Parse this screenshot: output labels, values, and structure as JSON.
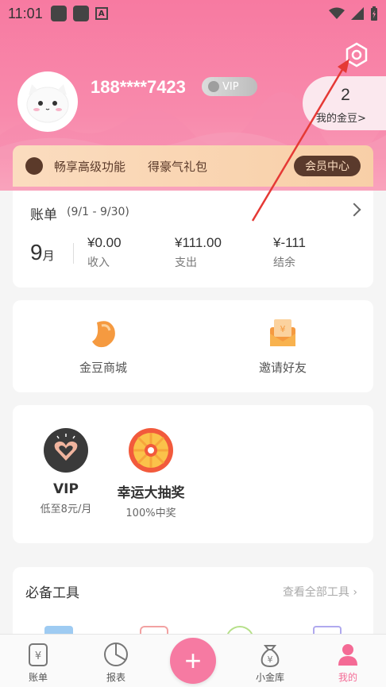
{
  "status_bar": {
    "time": "11:01"
  },
  "profile": {
    "phone": "188****7423",
    "vip_label": "VIP",
    "gold_count": "2",
    "gold_label": "我的金豆>"
  },
  "member_banner": {
    "text1": "畅享高级功能",
    "text2": "得豪气礼包",
    "button": "会员中心"
  },
  "bill": {
    "title": "账单",
    "range": "(9/1 - 9/30)",
    "month_num": "9",
    "month_unit": "月",
    "income_value": "¥0.00",
    "income_label": "收入",
    "expense_value": "¥111.00",
    "expense_label": "支出",
    "balance_value": "¥-111",
    "balance_label": "结余"
  },
  "shop": {
    "items": [
      {
        "label": "金豆商城"
      },
      {
        "label": "邀请好友"
      }
    ]
  },
  "promo": {
    "items": [
      {
        "title": "VIP",
        "sub": "低至8元/月"
      },
      {
        "title": "幸运大抽奖",
        "sub": "100%中奖"
      }
    ]
  },
  "tools": {
    "title": "必备工具",
    "link": "查看全部工具"
  },
  "tabbar": {
    "items": [
      {
        "label": "账单"
      },
      {
        "label": "报表"
      },
      {
        "label": "+"
      },
      {
        "label": "小金库"
      },
      {
        "label": "我的"
      }
    ]
  },
  "colors": {
    "brand_pink": "#f77aa1",
    "member_brown": "#5a3a2c",
    "annotation_red": "#e53935"
  }
}
